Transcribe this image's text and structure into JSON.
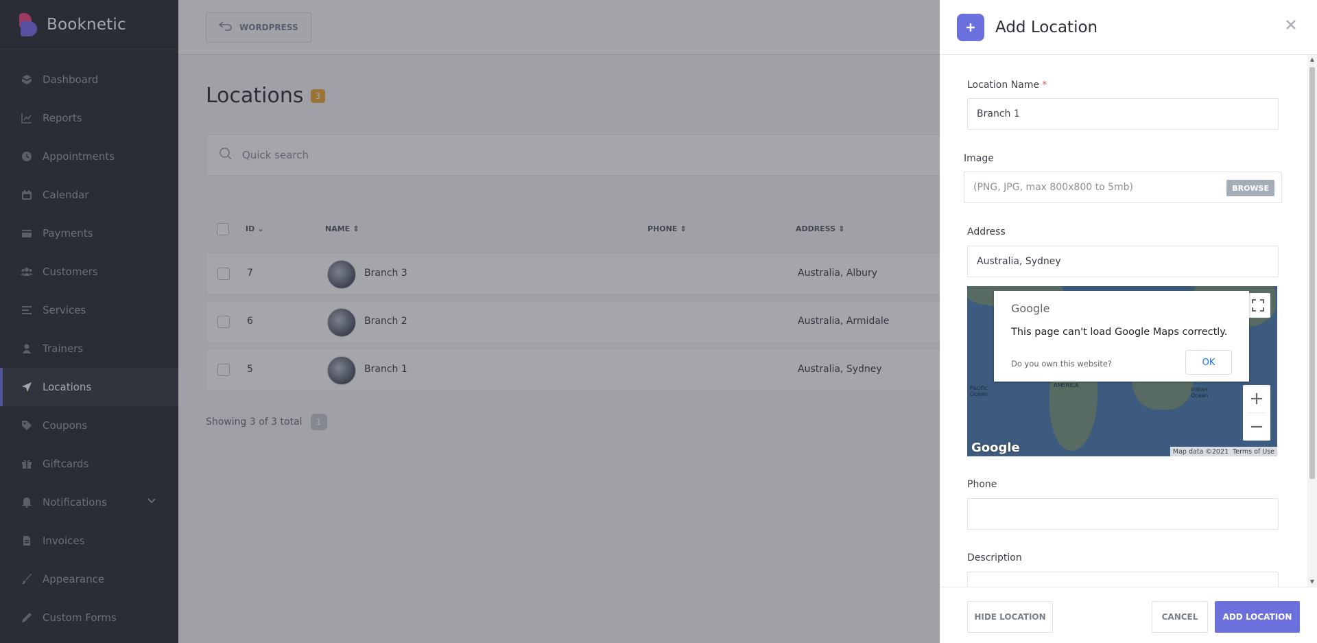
{
  "brand": {
    "name": "Booknetic"
  },
  "sidebar": {
    "items": [
      {
        "label": "Dashboard",
        "icon": "dashboard-icon"
      },
      {
        "label": "Reports",
        "icon": "chart-icon"
      },
      {
        "label": "Appointments",
        "icon": "clock-icon"
      },
      {
        "label": "Calendar",
        "icon": "calendar-icon"
      },
      {
        "label": "Payments",
        "icon": "wallet-icon"
      },
      {
        "label": "Customers",
        "icon": "users-icon"
      },
      {
        "label": "Services",
        "icon": "list-icon"
      },
      {
        "label": "Trainers",
        "icon": "user-icon"
      },
      {
        "label": "Locations",
        "icon": "location-arrow-icon",
        "active": true
      },
      {
        "label": "Coupons",
        "icon": "tag-icon"
      },
      {
        "label": "Giftcards",
        "icon": "gift-icon"
      },
      {
        "label": "Notifications",
        "icon": "bell-icon"
      },
      {
        "label": "Invoices",
        "icon": "file-icon"
      },
      {
        "label": "Appearance",
        "icon": "brush-icon"
      },
      {
        "label": "Custom Forms",
        "icon": "pencil-ruler-icon"
      }
    ]
  },
  "topbar": {
    "wordpress_label": "WORDPRESS"
  },
  "page": {
    "title": "Locations",
    "count": "3"
  },
  "search": {
    "placeholder": "Quick search"
  },
  "table": {
    "headers": {
      "id": "ID",
      "name": "NAME",
      "phone": "PHONE",
      "address": "ADDRESS"
    },
    "rows": [
      {
        "id": "7",
        "name": "Branch 3",
        "phone": "",
        "address": "Australia, Albury"
      },
      {
        "id": "6",
        "name": "Branch 2",
        "phone": "",
        "address": "Australia, Armidale"
      },
      {
        "id": "5",
        "name": "Branch 1",
        "phone": "",
        "address": "Australia, Sydney"
      }
    ],
    "footer": "Showing 3 of 3 total",
    "page_number": "1"
  },
  "panel": {
    "title": "Add Location",
    "location_name_label": "Location Name",
    "required_mark": "*",
    "location_name_value": "Branch 1",
    "image_label": "Image",
    "image_placeholder": "(PNG, JPG, max 800x800 to 5mb)",
    "browse_label": "BROWSE",
    "address_label": "Address",
    "address_value": "Australia, Sydney",
    "map": {
      "google_logo": "Google",
      "error_message": "This page can't load Google Maps correctly.",
      "own_website": "Do you own this website?",
      "ok_label": "OK",
      "map_data": "Map data ©2021",
      "terms": "Terms of Use",
      "label_america": "AMERICA",
      "label_pacific": "Pacific Ocean",
      "label_indian": "Indian Ocean"
    },
    "phone_label": "Phone",
    "phone_value": "",
    "description_label": "Description",
    "hide_location_label": "HIDE LOCATION",
    "cancel_label": "CANCEL",
    "add_location_label": "ADD LOCATION"
  },
  "colors": {
    "accent": "#6c70dc",
    "sidebar_bg": "#2b2f38",
    "badge": "#f0a83a",
    "brand_pink": "#f0477f"
  }
}
